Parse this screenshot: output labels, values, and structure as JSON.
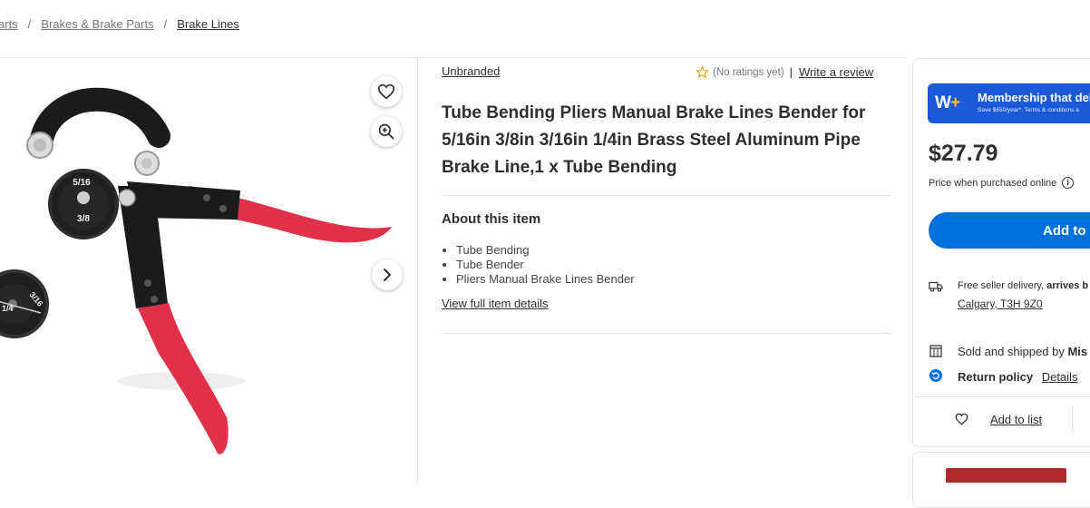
{
  "breadcrumb": {
    "items": [
      "arts",
      "Brakes & Brake Parts"
    ],
    "current": "Brake Lines",
    "separator": "/"
  },
  "gallery": {
    "image_labels": [
      "5/16",
      "3/8",
      "3/16",
      "1/4"
    ],
    "icons": [
      "heart-icon",
      "zoom-in-icon",
      "chevron-right-icon"
    ]
  },
  "product": {
    "brand": "Unbranded",
    "ratings_text": "(No ratings yet)",
    "ratings_separator": "|",
    "write_review": "Write a review",
    "title": "Tube Bending Pliers Manual Brake Lines Bender for 5/16in 3/8in 3/16in 1/4in Brass Steel Aluminum Pipe Brake Line,1 x Tube Bending",
    "about_heading": "About this item",
    "bullets": [
      "Tube Bending",
      "Tube Bender",
      "Pliers Manual Brake Lines Bender"
    ],
    "view_full": "View full item details"
  },
  "buybox": {
    "membership": {
      "logo_letter": "W",
      "logo_plus": "+",
      "headline": "Membership that del",
      "subtext": "Save $650/year*. Terms & conditions a"
    },
    "price": "$27.79",
    "price_note": "Price when purchased online",
    "info_symbol": "i",
    "add_button": "Add to c",
    "delivery_prefix": "Free seller delivery, ",
    "delivery_bold": "arrives b",
    "location": "Calgary, T3H 9Z0",
    "sold_by": "Sold and shipped by ",
    "sold_by_bold": "Mis",
    "return_policy": "Return policy",
    "details": "Details",
    "add_to_list": "Add to list"
  },
  "colors": {
    "primary_blue": "#0071dc",
    "membership_blue": "#1a59d8",
    "star_yellow": "#ffc220",
    "handle_red": "#e0304a",
    "text": "#2e2f32",
    "muted": "#74767c"
  }
}
